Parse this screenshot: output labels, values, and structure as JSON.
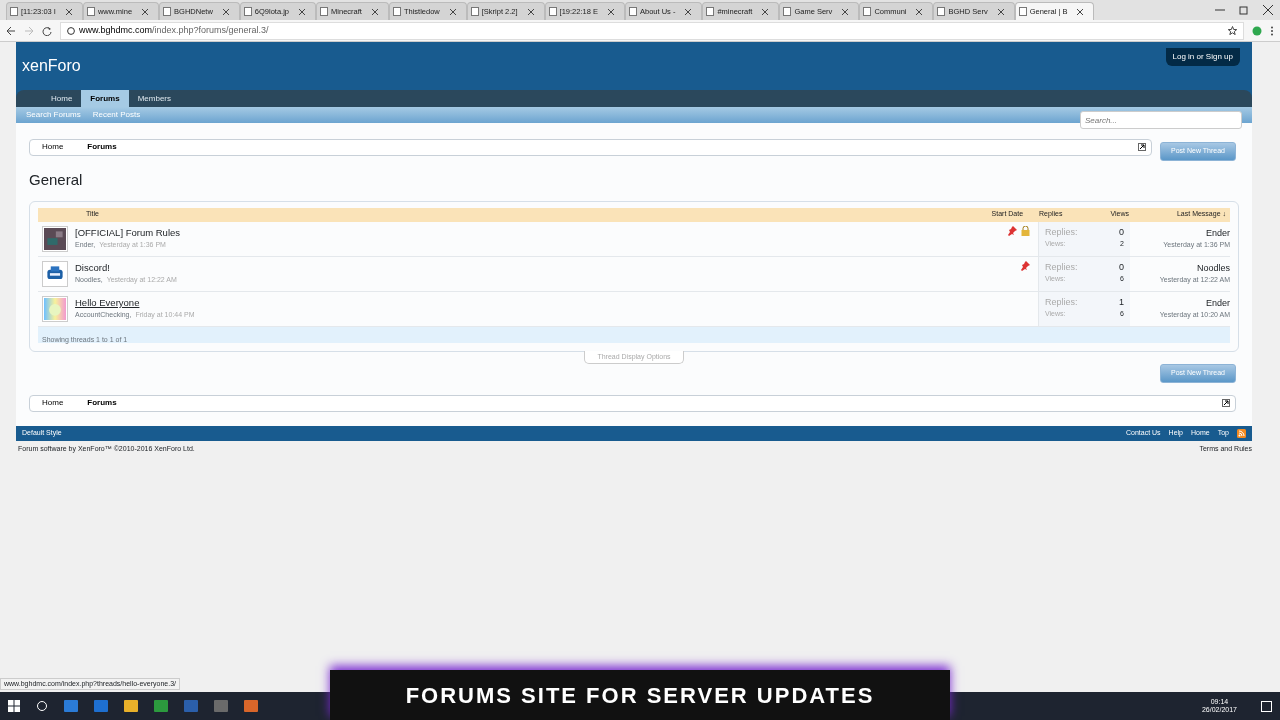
{
  "browser": {
    "tabs": [
      {
        "title": "[11:23:03 I",
        "selected": false
      },
      {
        "title": "www.mine",
        "selected": false
      },
      {
        "title": "BGHDNetw",
        "selected": false
      },
      {
        "title": "6Q9lota.jp",
        "selected": false
      },
      {
        "title": "Minecraft",
        "selected": false
      },
      {
        "title": "Thistledow",
        "selected": false
      },
      {
        "title": "[Skript 2.2]",
        "selected": false
      },
      {
        "title": "[19:22:18 E",
        "selected": false
      },
      {
        "title": "About Us -",
        "selected": false
      },
      {
        "title": "#minecraft",
        "selected": false
      },
      {
        "title": "Game Serv",
        "selected": false
      },
      {
        "title": "Communi",
        "selected": false
      },
      {
        "title": "BGHD Serv",
        "selected": false
      },
      {
        "title": "General | B",
        "selected": true
      }
    ],
    "url_host": "www.bghdmc.com",
    "url_path": "/index.php?forums/general.3/",
    "status_url": "www.bghdmc.com/index.php?threads/hello-everyone.3/"
  },
  "site": {
    "logo": "xenForo",
    "login": "Log in or Sign up",
    "nav": [
      {
        "label": "Home",
        "selected": false
      },
      {
        "label": "Forums",
        "selected": true
      },
      {
        "label": "Members",
        "selected": false
      }
    ],
    "subnav": [
      "Search Forums",
      "Recent Posts"
    ],
    "search": {
      "placeholder": "Search..."
    },
    "breadcrumb_top": [
      "Home",
      "Forums"
    ],
    "post_button_top": "Post New Thread",
    "title": "General",
    "columns": [
      "Title",
      "Start Date",
      "Replies",
      "Views",
      "Last Message ↓"
    ],
    "threads": [
      {
        "title": "[OFFICIAL] Forum Rules",
        "author": "Ender,",
        "date": "Yesterday at 1:36 PM",
        "sticky": true,
        "locked": true,
        "hovered": false,
        "replies_label": "Replies:",
        "replies": "0",
        "views_label": "Views:",
        "views": "2",
        "last_user": "Ender",
        "last_date": "Yesterday at 1:36 PM"
      },
      {
        "title": "Discord!",
        "author": "Noodles,",
        "date": "Yesterday at 12:22 AM",
        "sticky": true,
        "locked": false,
        "hovered": false,
        "replies_label": "Replies:",
        "replies": "0",
        "views_label": "Views:",
        "views": "6",
        "last_user": "Noodles",
        "last_date": "Yesterday at 12:22 AM"
      },
      {
        "title": "Hello Everyone",
        "author": "AccountChecking,",
        "date": "Friday at 10:44 PM",
        "sticky": false,
        "locked": false,
        "hovered": true,
        "replies_label": "Replies:",
        "replies": "1",
        "views_label": "Views:",
        "views": "6",
        "last_user": "Ender",
        "last_date": "Yesterday at 10:20 AM"
      }
    ],
    "showing": "Showing threads 1 to 1 of 1",
    "display_options": "Thread Display Options",
    "post_button_bottom": "Post New Thread",
    "breadcrumb_bottom": [
      "Home",
      "Forums"
    ],
    "footer_style": "Default Style",
    "footer_links": [
      "Contact Us",
      "Help",
      "Home",
      "Top"
    ],
    "copyright": "Forum software by XenForo™ ©2010-2016 XenForo Ltd.",
    "terms": "Terms and Rules"
  },
  "caption": "FORUMS SITE FOR SERVER UPDATES",
  "taskbar": {
    "time": "09:14",
    "date": "26/02/2017"
  }
}
